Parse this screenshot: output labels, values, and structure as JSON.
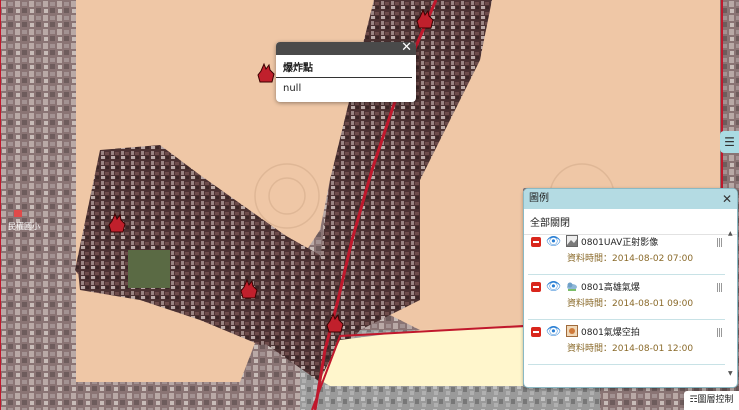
{
  "popup": {
    "title": "爆炸點",
    "value": "null",
    "close_glyph": "✕"
  },
  "side_tab": {
    "glyph": "☰"
  },
  "legend": {
    "title": "圖例",
    "close_glyph": "✕",
    "collapse_all": "全部關閉",
    "layers": [
      {
        "name": "0801UAV正射影像",
        "date": "資料時間：2014-08-02 07:00",
        "icon": "image-icon"
      },
      {
        "name": "0801高雄氣爆",
        "date": "資料時間：2014-08-01 09:00",
        "icon": "weather-icon"
      },
      {
        "name": "0801氣爆空拍",
        "date": "資料時間：2014-08-01 12:00",
        "icon": "photo-icon"
      }
    ],
    "scroll_up": "▲",
    "scroll_down": "▼"
  },
  "layer_control": {
    "label": "☶圖層控制"
  },
  "map_labels": {
    "school": "民權國小"
  },
  "colors": {
    "overlay": "#efc7a6",
    "red_line": "#c0182c",
    "legend_header": "#b4dbe3",
    "marker": "#c0202c"
  }
}
